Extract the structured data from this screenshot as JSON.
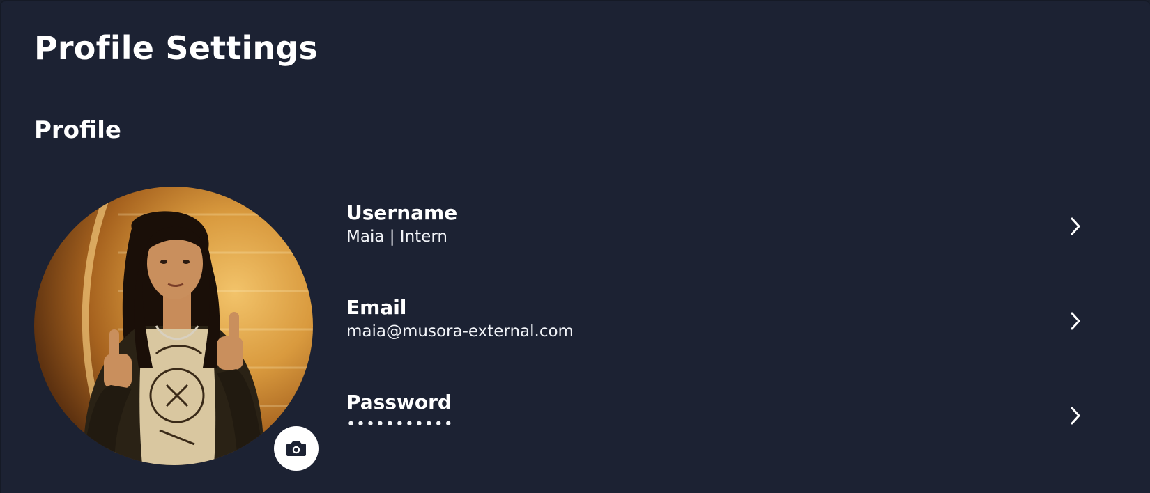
{
  "page": {
    "title": "Profile Settings"
  },
  "profile": {
    "section_title": "Profile",
    "avatar_alt": "profile-photo",
    "camera_icon": "camera-icon",
    "fields": [
      {
        "label": "Username",
        "value": "Maia | Intern",
        "icon": "chevron-right-icon"
      },
      {
        "label": "Email",
        "value": "maia@musora-external.com",
        "icon": "chevron-right-icon"
      },
      {
        "label": "Password",
        "value": "•••••••••••",
        "icon": "chevron-right-icon"
      }
    ]
  },
  "colors": {
    "background": "#1c2233",
    "text": "#ffffff",
    "camera_button": "#ffffff"
  }
}
